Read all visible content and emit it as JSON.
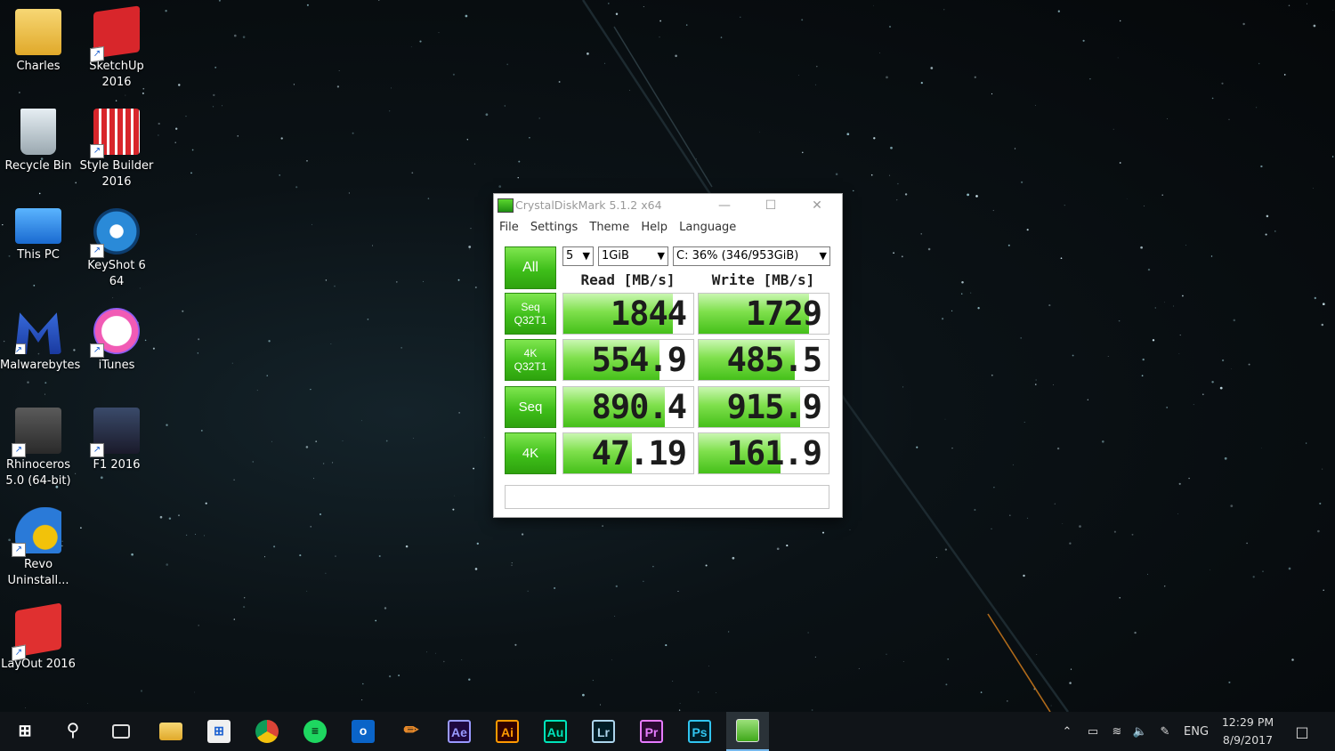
{
  "desktop": {
    "icons": [
      {
        "label": "Charles",
        "icon": "user-folder-icon"
      },
      {
        "label": "SketchUp\n2016",
        "icon": "sketchup-icon"
      },
      {
        "label": "Recycle Bin",
        "icon": "recycle-bin-icon"
      },
      {
        "label": "Style Builder\n2016",
        "icon": "style-builder-icon"
      },
      {
        "label": "This PC",
        "icon": "this-pc-icon"
      },
      {
        "label": "KeyShot 6 64",
        "icon": "keyshot-icon"
      },
      {
        "label": "Malwarebytes",
        "icon": "malwarebytes-icon"
      },
      {
        "label": "iTunes",
        "icon": "itunes-icon"
      },
      {
        "label": "Rhinoceros\n5.0 (64-bit)",
        "icon": "rhinoceros-icon"
      },
      {
        "label": "F1 2016",
        "icon": "f1-2016-icon"
      },
      {
        "label": "Revo\nUninstall...",
        "icon": "revo-uninstaller-icon"
      },
      {
        "label": "LayOut 2016",
        "icon": "layout-icon"
      }
    ]
  },
  "window": {
    "title": "CrystalDiskMark 5.1.2 x64",
    "menu": [
      "File",
      "Settings",
      "Theme",
      "Help",
      "Language"
    ],
    "all_button": "All",
    "count": "5",
    "size": "1GiB",
    "drive": "C: 36% (346/953GiB)",
    "headers": {
      "read": "Read [MB/s]",
      "write": "Write [MB/s]"
    },
    "rows": [
      {
        "label_line1": "Seq",
        "label_line2": "Q32T1",
        "read": "1844",
        "write": "1729",
        "read_level": 0.84,
        "write_level": 0.85
      },
      {
        "label_line1": "4K",
        "label_line2": "Q32T1",
        "read": "554.9",
        "write": "485.5",
        "read_level": 0.74,
        "write_level": 0.74
      },
      {
        "label_line1": "Seq",
        "label_line2": "",
        "read": "890.4",
        "write": "915.9",
        "read_level": 0.78,
        "write_level": 0.78
      },
      {
        "label_line1": "4K",
        "label_line2": "",
        "read": "47.19",
        "write": "161.9",
        "read_level": 0.53,
        "write_level": 0.63
      }
    ],
    "status": ""
  },
  "taskbar": {
    "apps": [
      {
        "name": "start",
        "icon": "windows-logo-icon"
      },
      {
        "name": "search",
        "icon": "search-icon"
      },
      {
        "name": "task-view",
        "icon": "task-view-icon"
      },
      {
        "name": "file-explorer",
        "icon": "folder-icon"
      },
      {
        "name": "store",
        "icon": "store-icon"
      },
      {
        "name": "chrome",
        "icon": "chrome-icon"
      },
      {
        "name": "spotify",
        "icon": "spotify-icon"
      },
      {
        "name": "outlook",
        "icon": "outlook-icon",
        "text": "o"
      },
      {
        "name": "pencil",
        "icon": "pencil-icon"
      },
      {
        "name": "after-effects",
        "icon": "after-effects-icon",
        "text": "Ae",
        "color": "#9999ff",
        "bg": "#1f0740"
      },
      {
        "name": "illustrator",
        "icon": "illustrator-icon",
        "text": "Ai",
        "color": "#ff9a00",
        "bg": "#330000"
      },
      {
        "name": "audition",
        "icon": "audition-icon",
        "text": "Au",
        "color": "#00e4bb",
        "bg": "#00200f"
      },
      {
        "name": "lightroom",
        "icon": "lightroom-icon",
        "text": "Lr",
        "color": "#add5ec",
        "bg": "#001d26"
      },
      {
        "name": "premiere",
        "icon": "premiere-icon",
        "text": "Pr",
        "color": "#e77bff",
        "bg": "#2a0a32"
      },
      {
        "name": "photoshop",
        "icon": "photoshop-icon",
        "text": "Ps",
        "color": "#31c5f0",
        "bg": "#001d26"
      },
      {
        "name": "crystaldiskmark",
        "icon": "crystaldiskmark-icon"
      }
    ],
    "tray": {
      "language": "ENG",
      "time": "12:29 PM",
      "date": "8/9/2017"
    }
  }
}
